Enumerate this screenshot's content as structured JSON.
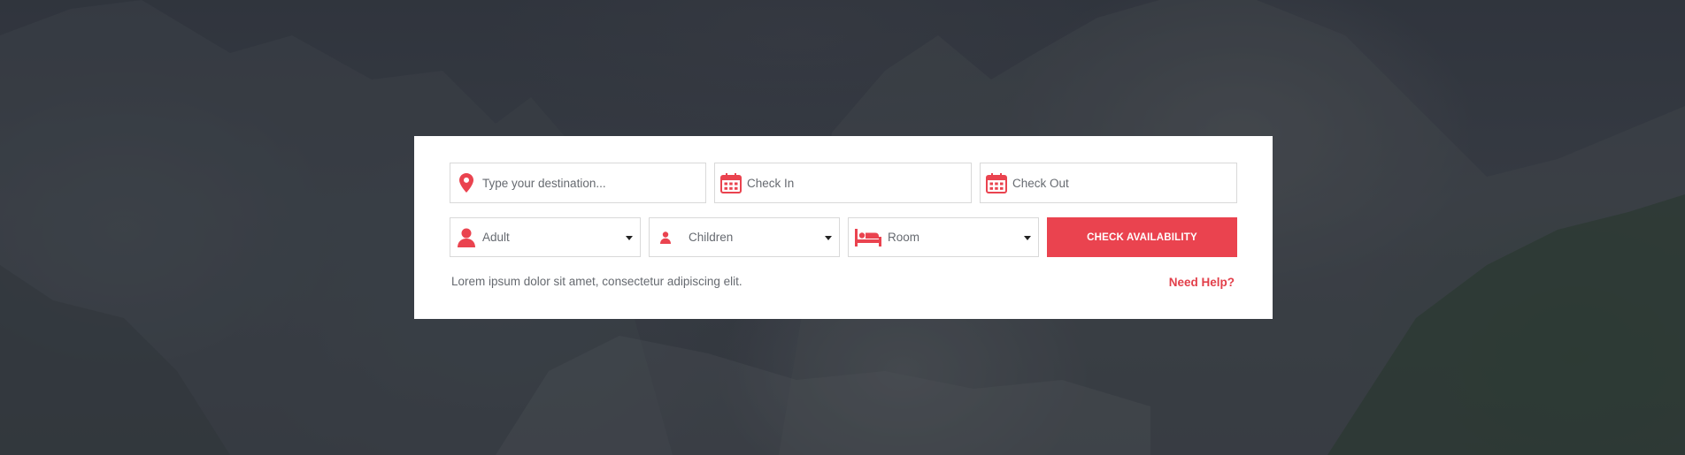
{
  "colors": {
    "accent": "#ea434f",
    "panel": "#ffffff",
    "field_border": "#d9d9d9",
    "text": "#666a70",
    "overlay": "#2b303a"
  },
  "search": {
    "destination": {
      "placeholder": "Type your destination...",
      "icon": "map-pin-icon"
    },
    "check_in": {
      "placeholder": "Check In",
      "icon": "calendar-icon"
    },
    "check_out": {
      "placeholder": "Check Out",
      "icon": "calendar-icon"
    }
  },
  "options": {
    "adult": {
      "label": "Adult",
      "icon": "user-icon"
    },
    "children": {
      "label": "Children",
      "icon": "child-icon"
    },
    "room": {
      "label": "Room",
      "icon": "bed-icon"
    }
  },
  "actions": {
    "check_availability": "CHECK AVAILABILITY",
    "need_help": "Need Help?"
  },
  "footer_note": "Lorem ipsum dolor sit amet, consectetur adipiscing elit."
}
